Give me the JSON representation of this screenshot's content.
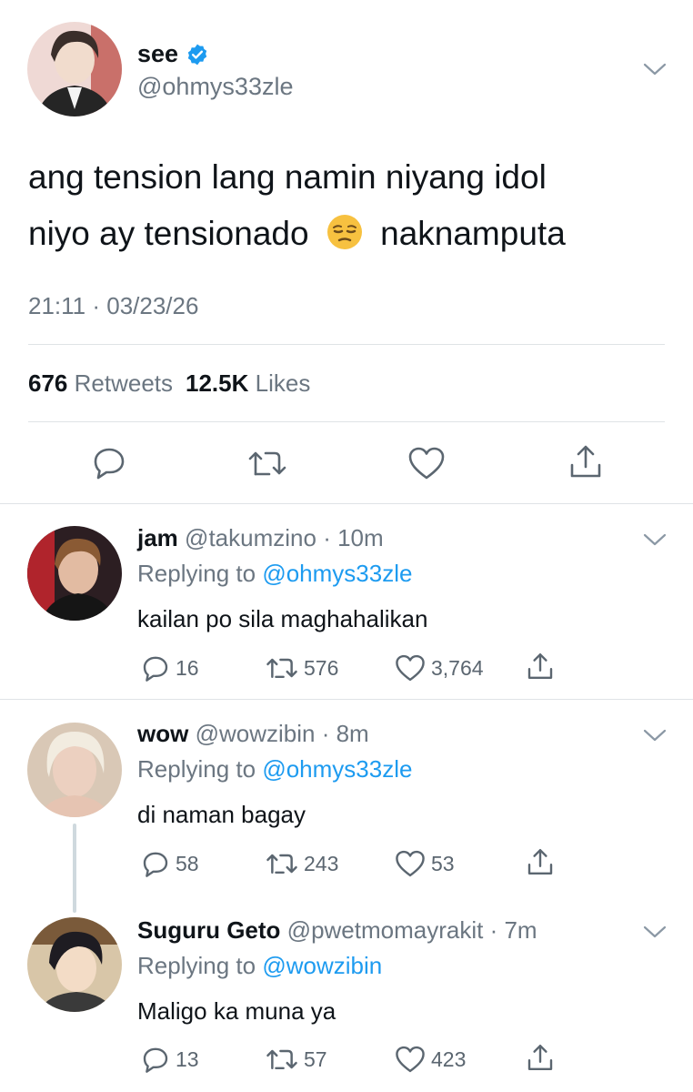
{
  "main_tweet": {
    "display_name": "see",
    "handle": "@ohmys33zle",
    "text_line1": "ang tension lang namin niyang idol",
    "text_line2_a": "niyo ay tensionado",
    "emoji": "😒",
    "text_line2_b": "naknamputa",
    "timestamp": "21:11 · 03/23/26",
    "retweets_count": "676",
    "retweets_label": "Retweets",
    "likes_count": "12.5K",
    "likes_label": "Likes",
    "icons": [
      "reply-icon",
      "retweet-icon",
      "like-icon",
      "share-icon"
    ]
  },
  "replies": [
    {
      "display_name": "jam",
      "handle": "@takumzino",
      "time": "· 10m",
      "replying_label": "Replying to",
      "replying_to": "@ohmys33zle",
      "text": "kailan po sila maghahalikan",
      "reply_count": "16",
      "retweet_count": "576",
      "like_count": "3,764"
    },
    {
      "display_name": "wow",
      "handle": "@wowzibin",
      "time": "· 8m",
      "replying_label": "Replying to",
      "replying_to": "@ohmys33zle",
      "text": "di naman bagay",
      "reply_count": "58",
      "retweet_count": "243",
      "like_count": "53"
    },
    {
      "display_name": "Suguru Geto",
      "handle": "@pwetmomayrakit",
      "time": "· 7m",
      "replying_label": "Replying to",
      "replying_to": "@wowzibin",
      "text": "Maligo ka muna ya",
      "reply_count": "13",
      "retweet_count": "57",
      "like_count": "423"
    }
  ],
  "colors": {
    "link": "#1d9bf0",
    "secondary_text": "#6b7681",
    "verified": "#1d9bf0"
  }
}
